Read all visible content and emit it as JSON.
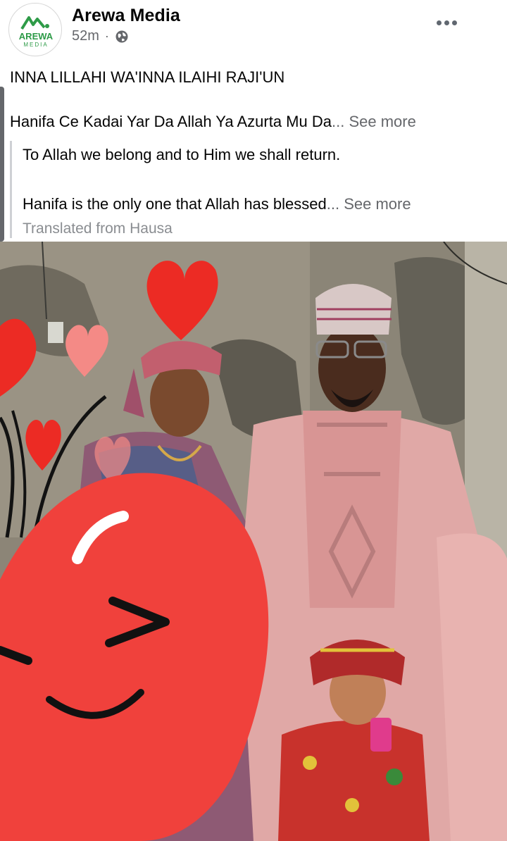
{
  "post": {
    "page_name": "Arewa Media",
    "time": "52m",
    "separator": "·",
    "audience_icon": "globe-icon",
    "avatar_logo_text": "AREWA",
    "avatar_logo_subtext": "MEDIA",
    "menu_icon": "more-horizontal-icon",
    "headline": "INNA LILLAHI WA'INNA ILAIHI RAJI'UN",
    "hausa_text": "Hanifa Ce Kadai Yar Da Allah Ya Azurta Mu Da",
    "ellipsis": "...",
    "see_more": "See more",
    "translation": {
      "line1": "To Allah we belong and to Him we shall return.",
      "line2": "Hanifa is the only one that Allah has blessed",
      "see_more": "See more",
      "note": "Translated from Hausa"
    }
  },
  "colors": {
    "text": "#050505",
    "secondary": "#65676b",
    "muted": "#8a8d91",
    "brand_green": "#2e9b48",
    "sticker_red": "#f0413c"
  }
}
